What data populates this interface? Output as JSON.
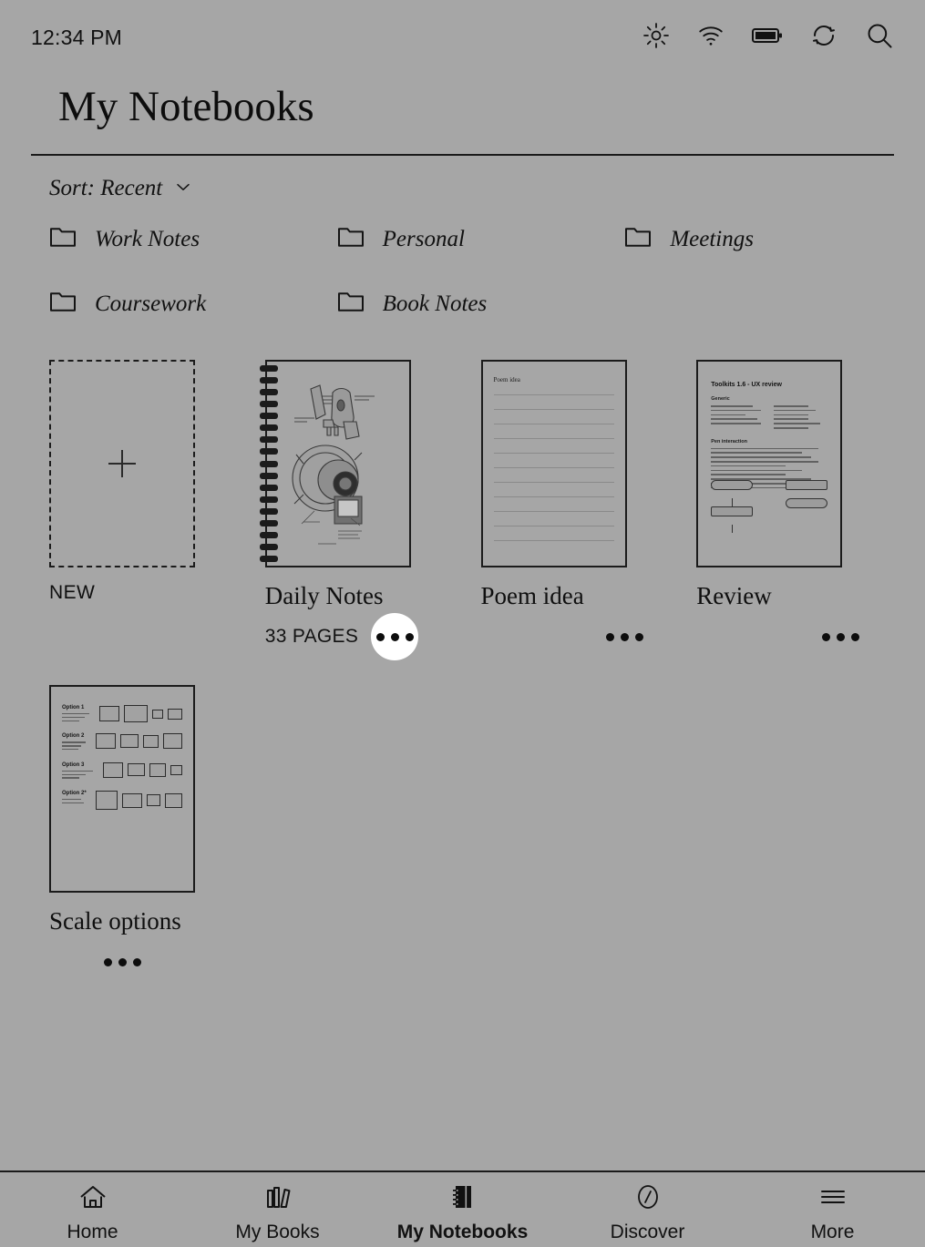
{
  "statusbar": {
    "time": "12:34 PM",
    "icons": [
      {
        "name": "brightness-icon",
        "label": "Brightness"
      },
      {
        "name": "wifi-icon",
        "label": "Wi-Fi"
      },
      {
        "name": "battery-icon",
        "label": "Battery"
      },
      {
        "name": "sync-icon",
        "label": "Sync"
      },
      {
        "name": "search-icon",
        "label": "Search"
      }
    ]
  },
  "header": {
    "title": "My Notebooks"
  },
  "sort": {
    "label": "Sort: Recent",
    "chevron": "chevron-down-icon"
  },
  "folders": [
    {
      "label": "Work Notes"
    },
    {
      "label": "Personal"
    },
    {
      "label": "Meetings"
    },
    {
      "label": "Coursework"
    },
    {
      "label": "Book Notes"
    }
  ],
  "notebooks": [
    {
      "kind": "new",
      "name": "NEW",
      "pages": "",
      "menu": "more-options-icon",
      "menu_active": false
    },
    {
      "kind": "sketch",
      "name": "Daily Notes",
      "pages": "33 PAGES",
      "menu": "more-options-icon",
      "menu_active": true
    },
    {
      "kind": "ruled",
      "name": "Poem idea",
      "pages": "",
      "thumb_title": "Poem idea",
      "menu": "more-options-icon",
      "menu_active": false
    },
    {
      "kind": "doc",
      "name": "Review",
      "pages": "",
      "thumb_title": "Toolkits 1.6 - UX review",
      "thumb_headings": [
        "Generic",
        "Pen interaction"
      ],
      "menu": "more-options-icon",
      "menu_active": false
    },
    {
      "kind": "scale",
      "name": "Scale options",
      "pages": "",
      "thumb_options": [
        "Option 1",
        "Option 2",
        "Option 3",
        "Option 2*"
      ],
      "menu": "more-options-icon",
      "menu_active": false
    }
  ],
  "nav": [
    {
      "label": "Home",
      "icon": "home-icon",
      "active": false
    },
    {
      "label": "My Books",
      "icon": "books-icon",
      "active": false
    },
    {
      "label": "My Notebooks",
      "icon": "notebook-icon",
      "active": true
    },
    {
      "label": "Discover",
      "icon": "compass-icon",
      "active": false
    },
    {
      "label": "More",
      "icon": "menu-icon",
      "active": false
    }
  ],
  "colors": {
    "background": "#a6a6a6",
    "ink": "#111111",
    "highlight": "#ffffff"
  }
}
